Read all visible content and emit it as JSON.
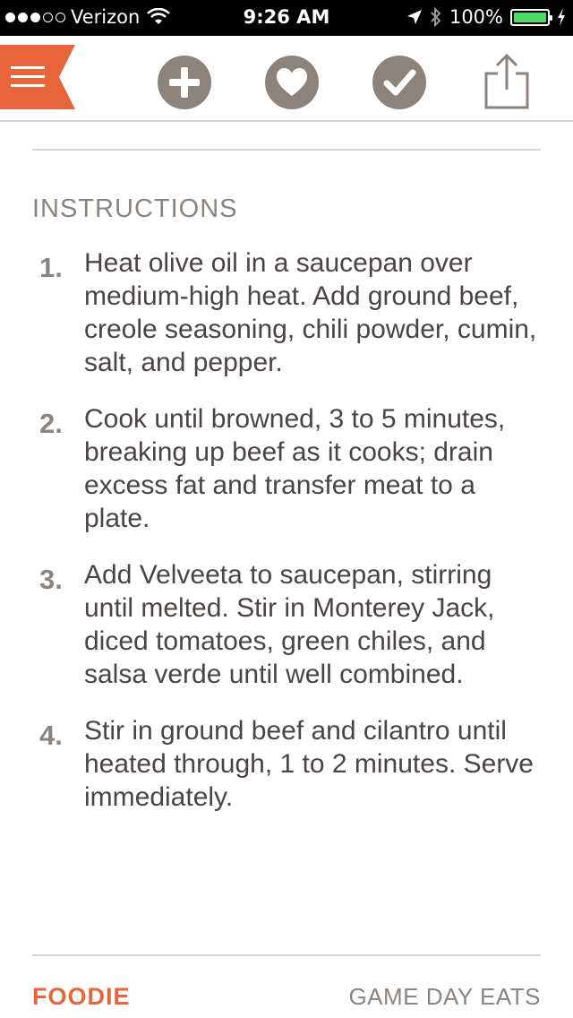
{
  "status_bar": {
    "carrier": "Verizon",
    "time": "9:26 AM",
    "battery": "100%",
    "signal_bars_filled": 3,
    "signal_bars_total": 5
  },
  "toolbar": {
    "menu_icon": "hamburger-flag-icon",
    "add_icon": "plus-icon",
    "favorite_icon": "heart-icon",
    "done_icon": "check-icon",
    "share_icon": "share-icon"
  },
  "colors": {
    "brand": "#e8643a",
    "button_gray": "#8c837d",
    "text": "#4a4542",
    "muted": "#8b8581"
  },
  "content": {
    "section_title": "INSTRUCTIONS",
    "steps": [
      {
        "number": "1.",
        "text": "Heat olive oil in a saucepan over medium-high heat. Add ground beef, creole seasoning, chili powder, cumin, salt, and pepper."
      },
      {
        "number": "2.",
        "text": "Cook until browned, 3 to 5 minutes, breaking up beef as it cooks; drain excess fat and transfer meat to a plate."
      },
      {
        "number": "3.",
        "text": "Add Velveeta to saucepan, stirring until melted. Stir in Monterey Jack, diced tomatoes, green chiles, and salsa verde until well combined."
      },
      {
        "number": "4.",
        "text": "Stir in ground beef and cilantro until heated through, 1 to 2 minutes. Serve immediately."
      }
    ]
  },
  "footer": {
    "brand": "FOODIE",
    "section": "GAME DAY EATS"
  }
}
